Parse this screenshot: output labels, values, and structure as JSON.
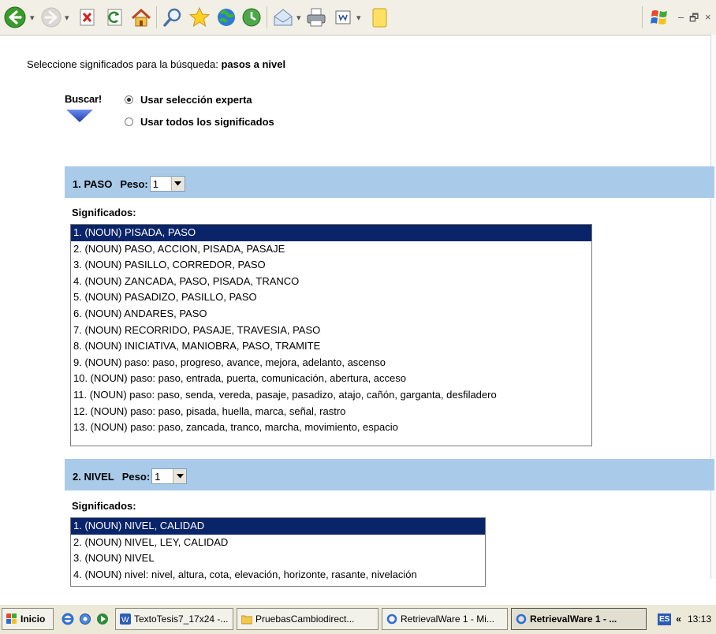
{
  "toolbar": {
    "icons": [
      "back-icon",
      "forward-icon",
      "stop-icon",
      "refresh-icon",
      "home-icon",
      "search-icon",
      "favorites-icon",
      "media-icon",
      "history-icon",
      "mail-icon",
      "print-icon",
      "edit-icon",
      "notes-icon",
      "windows-logo-icon"
    ],
    "window_controls": {
      "minimize": "–",
      "restore": "🗗",
      "close": "×"
    }
  },
  "prompt": {
    "text": "Seleccione significados para la búsqueda: ",
    "query": "pasos a nivel"
  },
  "buscar": {
    "label": "Buscar!"
  },
  "radios": [
    {
      "label": "Usar selección experta",
      "checked": true
    },
    {
      "label": "Usar todos los significados",
      "checked": false
    }
  ],
  "sections": [
    {
      "title": "1. PASO",
      "peso_label": "Peso:",
      "peso_value": "1",
      "significados_label": "Significados:",
      "options": [
        "1. (NOUN) PISADA, PASO",
        "2. (NOUN) PASO, ACCION, PISADA, PASAJE",
        "3. (NOUN) PASILLO, CORREDOR, PASO",
        "4. (NOUN) ZANCADA, PASO, PISADA, TRANCO",
        "5. (NOUN) PASADIZO, PASILLO, PASO",
        "6. (NOUN) ANDARES, PASO",
        "7. (NOUN) RECORRIDO, PASAJE, TRAVESIA, PASO",
        "8. (NOUN) INICIATIVA, MANIOBRA, PASO, TRAMITE",
        "9. (NOUN) paso: paso, progreso, avance, mejora, adelanto, ascenso",
        "10. (NOUN) paso: paso, entrada, puerta, comunicación, abertura, acceso",
        "11. (NOUN) paso: paso, senda, vereda, pasaje, pasadizo, atajo, cañón, garganta, desfiladero",
        "12. (NOUN) paso: paso, pisada, huella, marca, señal, rastro",
        "13. (NOUN) paso: paso, zancada, tranco, marcha, movimiento, espacio"
      ],
      "selected_index": 0
    },
    {
      "title": "2. NIVEL",
      "peso_label": "Peso:",
      "peso_value": "1",
      "significados_label": "Significados:",
      "options": [
        "1. (NOUN) NIVEL, CALIDAD",
        "2. (NOUN) NIVEL, LEY, CALIDAD",
        "3. (NOUN) NIVEL",
        "4. (NOUN) nivel: nivel, altura, cota, elevación, horizonte, rasante, nivelación"
      ],
      "selected_index": 0
    }
  ],
  "taskbar": {
    "start_label": "Inicio",
    "buttons": [
      {
        "label": "TextoTesis7_17x24 -...",
        "icon": "word-icon",
        "active": false
      },
      {
        "label": "PruebasCambiodirect...",
        "icon": "folder-icon",
        "active": false
      },
      {
        "label": "RetrievalWare 1 - Mi...",
        "icon": "ie-icon",
        "active": false
      },
      {
        "label": "RetrievalWare 1 - ...",
        "icon": "ie-icon",
        "active": true
      }
    ],
    "language": "ES",
    "tray_arrow": "«",
    "clock": "13:13"
  },
  "colors": {
    "section_band": "#a9cbe9",
    "selected_option_bg": "#0a246a",
    "buscar_arrow": "#2f4fb8"
  }
}
